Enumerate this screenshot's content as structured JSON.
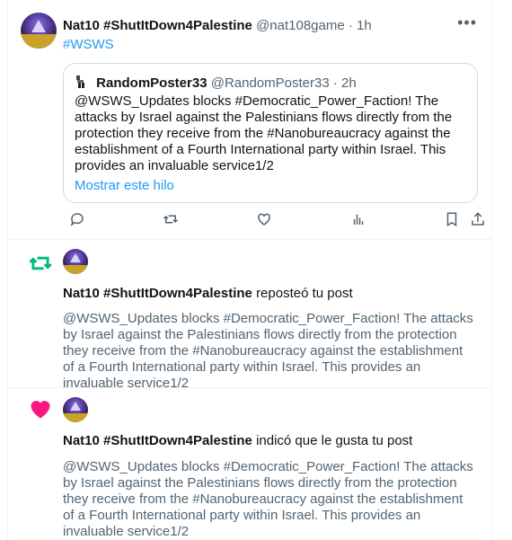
{
  "post": {
    "author_name": "Nat10 #ShutItDown4Palestine",
    "author_handle": "@nat108game",
    "separator": "·",
    "time": "1h",
    "hashtag": "#WSWS",
    "more_label": "•••",
    "quote": {
      "author_name": "RandomPoster33",
      "author_handle": "@RandomPoster33",
      "separator": "·",
      "time": "2h",
      "text": "@WSWS_Updates blocks #Democratic_Power_Faction! The attacks by Israel against the Palestinians flows directly from the protection they receive from the #Nanobureaucracy against the establishment of a Fourth International party within Israel. This provides an invaluable service1/2",
      "show_thread": "Mostrar este hilo"
    },
    "actions": [
      "reply-icon",
      "retweet-icon",
      "like-icon",
      "analytics-icon",
      "bookmark-icon",
      "share-icon"
    ]
  },
  "notifications": [
    {
      "type": "retweet",
      "icon": "retweet-icon",
      "icon_color": "#00ba7c",
      "actor": "Nat10 #ShutItDown4Palestine",
      "action": "reposteó tu post",
      "text": "@WSWS_Updates blocks #Democratic_Power_Faction! The attacks by Israel against the Palestinians flows directly from the protection they receive from the #Nanobureaucracy against the establishment of a Fourth International party within Israel. This provides an invaluable service1/2"
    },
    {
      "type": "like",
      "icon": "heart-icon",
      "icon_color": "#f91880",
      "actor": "Nat10 #ShutItDown4Palestine",
      "action": "indicó que le gusta tu post",
      "text": "@WSWS_Updates blocks #Democratic_Power_Faction! The attacks by Israel against the Palestinians flows directly from the protection they receive from the #Nanobureaucracy against the establishment of a Fourth International party within Israel. This provides an invaluable service1/2"
    }
  ],
  "colors": {
    "accent": "#1d9bf0",
    "muted": "#536471",
    "border": "#eff3f4"
  }
}
